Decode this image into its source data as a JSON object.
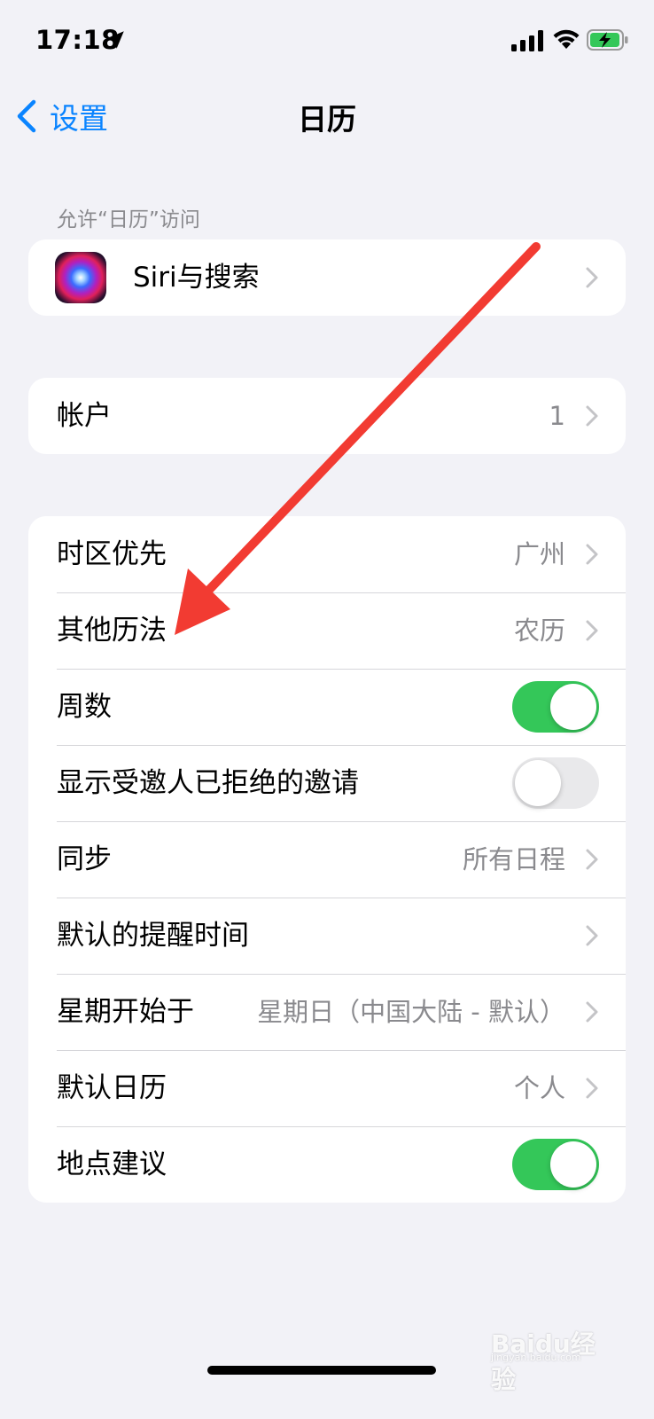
{
  "status_bar": {
    "time": "17:18",
    "icons": [
      "location-arrow-icon",
      "cellular-signal-icon",
      "wifi-icon",
      "battery-charging-icon"
    ]
  },
  "nav": {
    "back_label": "设置",
    "title": "日历"
  },
  "section_access": {
    "header": "允许“日历”访问",
    "siri_label": "Siri与搜索"
  },
  "section_accounts": {
    "label": "帐户",
    "value": "1"
  },
  "section_settings": {
    "rows": [
      {
        "label": "时区优先",
        "value": "广州"
      },
      {
        "label": "其他历法",
        "value": "农历"
      },
      {
        "label": "周数",
        "toggle": true
      },
      {
        "label": "显示受邀人已拒绝的邀请",
        "toggle": false
      },
      {
        "label": "同步",
        "value": "所有日程"
      },
      {
        "label": "默认的提醒时间",
        "value": ""
      },
      {
        "label": "星期开始于",
        "value": "星期日（中国大陆 - 默认）"
      },
      {
        "label": "默认日历",
        "value": "个人"
      },
      {
        "label": "地点建议",
        "toggle": true
      }
    ]
  },
  "colors": {
    "accent": "#0a84ff",
    "toggle_on": "#34c759",
    "annotation_arrow": "#f23b32"
  },
  "watermark": {
    "text": "Baidu经验",
    "url": "jingyan.baidu.com"
  }
}
